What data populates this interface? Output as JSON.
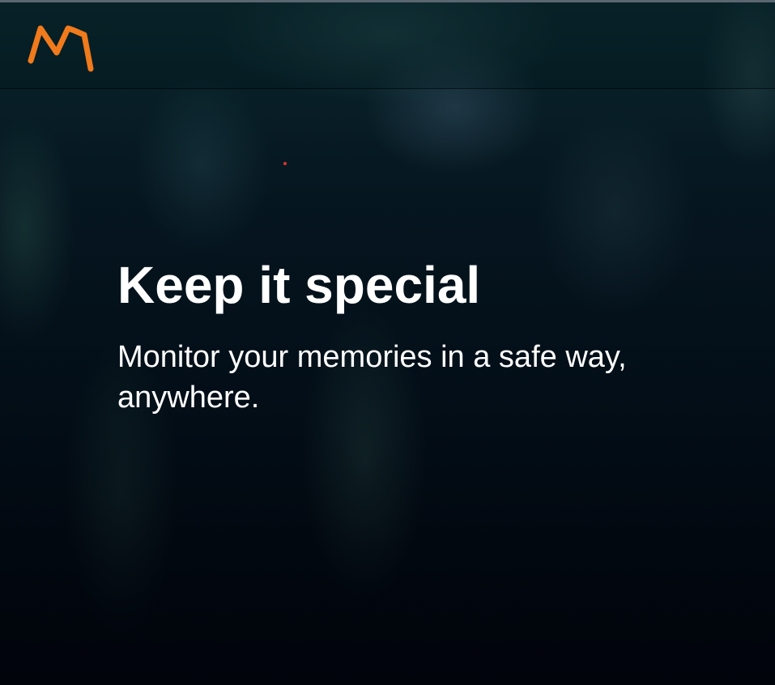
{
  "header": {
    "logo_icon": "m-logo-icon",
    "logo_color": "#f07a1c"
  },
  "hero": {
    "title": "Keep it special",
    "subtitle": "Monitor your memories in a safe way, anywhere.",
    "background_image": "crowd-photo",
    "text_color": "#ffffff"
  }
}
